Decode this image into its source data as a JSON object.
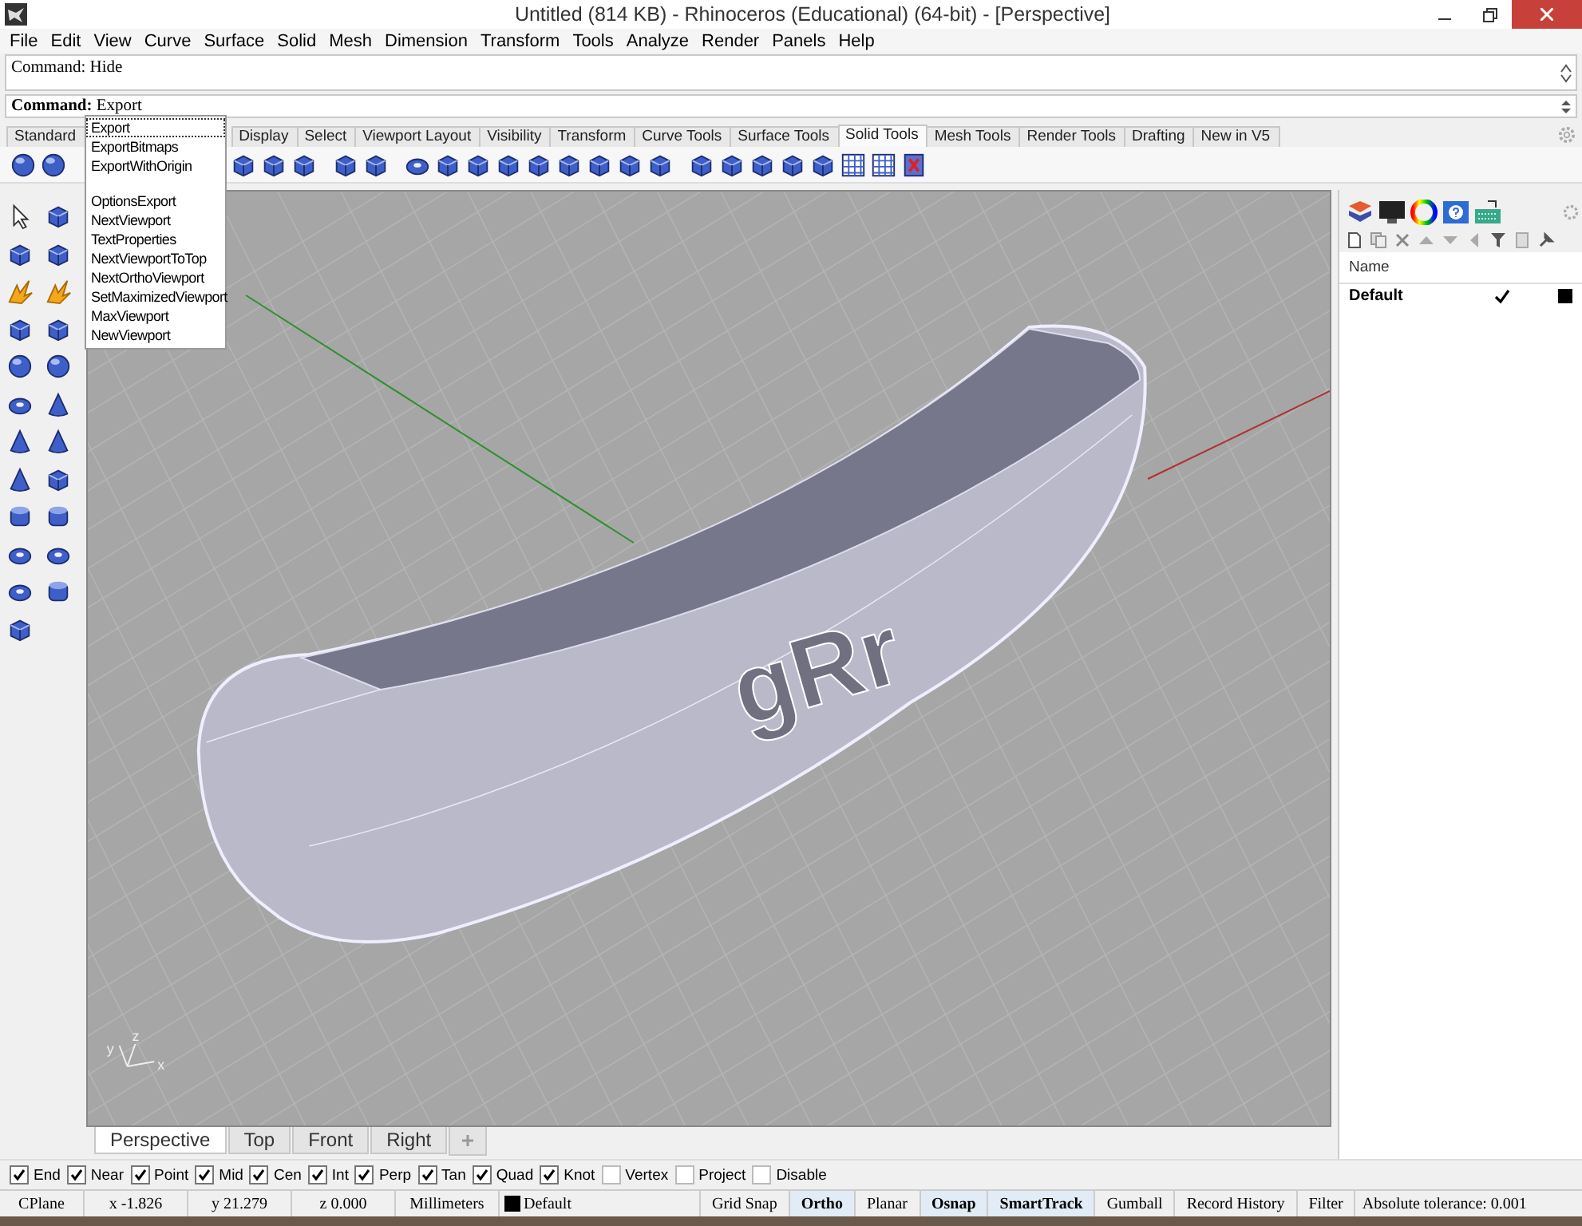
{
  "window": {
    "title": "Untitled (814 KB) - Rhinoceros (Educational) (64-bit) - [Perspective]"
  },
  "menu": [
    "File",
    "Edit",
    "View",
    "Curve",
    "Surface",
    "Solid",
    "Mesh",
    "Dimension",
    "Transform",
    "Tools",
    "Analyze",
    "Render",
    "Panels",
    "Help"
  ],
  "command": {
    "history": "Command: Hide",
    "prompt": "Command:",
    "value": "Export"
  },
  "autocomplete": [
    {
      "kind": "command",
      "label": "Export",
      "selected": true
    },
    {
      "kind": "command",
      "label": "ExportBitmaps",
      "selected": false
    },
    {
      "kind": "command",
      "label": "ExportWithOrigin",
      "selected": false
    },
    {
      "kind": "separator"
    },
    {
      "kind": "command",
      "label": "OptionsExport",
      "selected": false
    },
    {
      "kind": "command",
      "label": "NextViewport",
      "selected": false
    },
    {
      "kind": "command",
      "label": "TextProperties",
      "selected": false
    },
    {
      "kind": "command",
      "label": "NextViewportToTop",
      "selected": false
    },
    {
      "kind": "command",
      "label": "NextOrthoViewport",
      "selected": false
    },
    {
      "kind": "command",
      "label": "SetMaximizedViewport",
      "selected": false
    },
    {
      "kind": "command",
      "label": "MaxViewport",
      "selected": false
    },
    {
      "kind": "command",
      "label": "NewViewport",
      "selected": false
    }
  ],
  "toolbar_tabs": [
    {
      "label": "Standard",
      "selected": false
    },
    {
      "label": "Display",
      "selected": false
    },
    {
      "label": "Select",
      "selected": false
    },
    {
      "label": "Viewport Layout",
      "selected": false
    },
    {
      "label": "Visibility",
      "selected": false
    },
    {
      "label": "Transform",
      "selected": false
    },
    {
      "label": "Curve Tools",
      "selected": false
    },
    {
      "label": "Surface Tools",
      "selected": false
    },
    {
      "label": "Solid Tools",
      "selected": true
    },
    {
      "label": "Mesh Tools",
      "selected": false
    },
    {
      "label": "Render Tools",
      "selected": false
    },
    {
      "label": "Drafting",
      "selected": false
    },
    {
      "label": "New in V5",
      "selected": false
    }
  ],
  "viewport": {
    "model_text": "gRr",
    "axis_labels": [
      "y",
      "z",
      "x"
    ]
  },
  "viewport_tabs": [
    {
      "label": "Perspective",
      "selected": true
    },
    {
      "label": "Top",
      "selected": false
    },
    {
      "label": "Front",
      "selected": false
    },
    {
      "label": "Right",
      "selected": false
    }
  ],
  "layers": {
    "columns": [
      "Name"
    ],
    "rows": [
      {
        "name": "Default",
        "current": true,
        "color": "#000000"
      }
    ]
  },
  "osnaps": [
    {
      "label": "End",
      "checked": true
    },
    {
      "label": "Near",
      "checked": true
    },
    {
      "label": "Point",
      "checked": true
    },
    {
      "label": "Mid",
      "checked": true
    },
    {
      "label": "Cen",
      "checked": true
    },
    {
      "label": "Int",
      "checked": true
    },
    {
      "label": "Perp",
      "checked": true
    },
    {
      "label": "Tan",
      "checked": true
    },
    {
      "label": "Quad",
      "checked": true
    },
    {
      "label": "Knot",
      "checked": true
    },
    {
      "label": "Vertex",
      "checked": false
    },
    {
      "label": "Project",
      "checked": false
    },
    {
      "label": "Disable",
      "checked": false
    }
  ],
  "status": {
    "cplane": "CPlane",
    "x": "x -1.826",
    "y": "y 21.279",
    "z": "z 0.000",
    "units": "Millimeters",
    "layer": {
      "name": "Default",
      "color": "#000000"
    },
    "toggles": [
      {
        "label": "Grid Snap",
        "on": false
      },
      {
        "label": "Ortho",
        "on": true
      },
      {
        "label": "Planar",
        "on": false
      },
      {
        "label": "Osnap",
        "on": true
      },
      {
        "label": "SmartTrack",
        "on": true
      },
      {
        "label": "Gumball",
        "on": false
      },
      {
        "label": "Record History",
        "on": false
      },
      {
        "label": "Filter",
        "on": false
      }
    ],
    "tolerance": "Absolute tolerance: 0.001"
  }
}
